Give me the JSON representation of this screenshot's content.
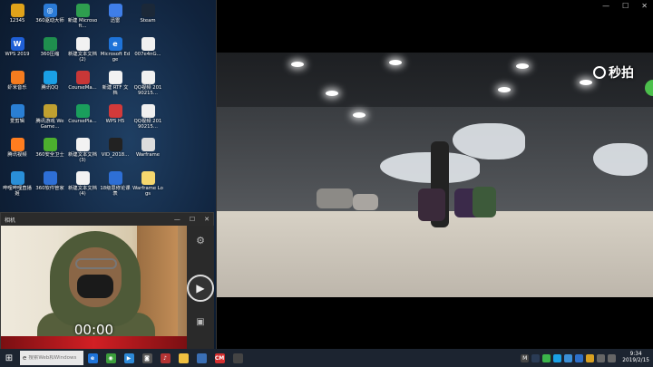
{
  "desktop": {
    "icons": [
      {
        "label": "12345",
        "color": "#e0a31a",
        "glyph": ""
      },
      {
        "label": "360驱动大师",
        "color": "#2b7bd6",
        "glyph": "◎"
      },
      {
        "label": "新建 Microsoft...",
        "color": "#2e9e4f",
        "glyph": ""
      },
      {
        "label": "迅雷",
        "color": "#3f7ee8",
        "glyph": ""
      },
      {
        "label": "Steam",
        "color": "#1b2838",
        "glyph": ""
      },
      {
        "label": "",
        "color": "transparent",
        "glyph": ""
      },
      {
        "label": "WPS 2019",
        "color": "#1f5fd6",
        "glyph": "W"
      },
      {
        "label": "360压缩",
        "color": "#1f8f4e",
        "glyph": ""
      },
      {
        "label": "新建文本文档 (2)",
        "color": "#f2f2f2",
        "glyph": ""
      },
      {
        "label": "Microsoft Edge",
        "color": "#1e73d8",
        "glyph": "e"
      },
      {
        "label": "007e4nG...",
        "color": "#f0f0f0",
        "glyph": ""
      },
      {
        "label": "",
        "color": "transparent",
        "glyph": ""
      },
      {
        "label": "虾米音乐",
        "color": "#f57c1f",
        "glyph": ""
      },
      {
        "label": "腾讯QQ",
        "color": "#1aa0e6",
        "glyph": ""
      },
      {
        "label": "CourseMa...",
        "color": "#c83737",
        "glyph": ""
      },
      {
        "label": "新建 RTF 文档",
        "color": "#f2f2f2",
        "glyph": ""
      },
      {
        "label": "QQ视频 20190215...",
        "color": "#f0f0f0",
        "glyph": ""
      },
      {
        "label": "",
        "color": "transparent",
        "glyph": ""
      },
      {
        "label": "爱剪辑",
        "color": "#2a7fd4",
        "glyph": ""
      },
      {
        "label": "腾讯游戏 WeGame...",
        "color": "#c0a030",
        "glyph": ""
      },
      {
        "label": "CoursePla...",
        "color": "#1a9e5c",
        "glyph": ""
      },
      {
        "label": "WPS H5",
        "color": "#d23a3a",
        "glyph": ""
      },
      {
        "label": "QQ视频 20190215...",
        "color": "#f0f0f0",
        "glyph": ""
      },
      {
        "label": "",
        "color": "transparent",
        "glyph": ""
      },
      {
        "label": "腾讯视频",
        "color": "#ff7d1f",
        "glyph": ""
      },
      {
        "label": "360安全卫士",
        "color": "#4caf2e",
        "glyph": ""
      },
      {
        "label": "新建文本文档 (3)",
        "color": "#f2f2f2",
        "glyph": ""
      },
      {
        "label": "VID_2018...",
        "color": "#222222",
        "glyph": ""
      },
      {
        "label": "Warframe",
        "color": "#dcdcdc",
        "glyph": ""
      },
      {
        "label": "",
        "color": "transparent",
        "glyph": ""
      },
      {
        "label": "哔哩哔哩直播姬",
        "color": "#2a8fd8",
        "glyph": ""
      },
      {
        "label": "360软件管家",
        "color": "#2e6fd6",
        "glyph": ""
      },
      {
        "label": "新建文本文档 (4)",
        "color": "#f2f2f2",
        "glyph": ""
      },
      {
        "label": "18级思修论课表",
        "color": "#2e6fd6",
        "glyph": ""
      },
      {
        "label": "Warframe Logs",
        "color": "#f5d76e",
        "glyph": ""
      },
      {
        "label": "",
        "color": "transparent",
        "glyph": ""
      }
    ]
  },
  "camera": {
    "title": "相机",
    "controls": [
      "—",
      "☐",
      "✕"
    ],
    "timer": "00:00",
    "settings_icon": "⚙",
    "record_icon": "▶",
    "photo_icon": "▣"
  },
  "player": {
    "controls": [
      "—",
      "☐",
      "✕"
    ],
    "watermark": "秒拍"
  },
  "taskbar": {
    "start_glyph": "⊞",
    "search_placeholder": "搜索Web和Windows",
    "search_icon": "e",
    "apps": [
      {
        "name": "edge",
        "color": "#1e73d8",
        "glyph": "e"
      },
      {
        "name": "app-green",
        "color": "#3c9e3c",
        "glyph": "◉"
      },
      {
        "name": "store",
        "color": "#2e8ad8",
        "glyph": "▶"
      },
      {
        "name": "camera",
        "color": "#555555",
        "glyph": "◙"
      },
      {
        "name": "music",
        "color": "#b33333",
        "glyph": "♪"
      },
      {
        "name": "explorer",
        "color": "#f0c040",
        "glyph": ""
      },
      {
        "name": "photos",
        "color": "#3a6fb5",
        "glyph": ""
      },
      {
        "name": "cm",
        "color": "#d42e2e",
        "glyph": "CM"
      },
      {
        "name": "film",
        "color": "#444444",
        "glyph": ""
      }
    ],
    "tray": [
      {
        "name": "m-icon",
        "color": "#444444",
        "glyph": "M"
      },
      {
        "name": "steam",
        "color": "#2a3b55",
        "glyph": ""
      },
      {
        "name": "wechat",
        "color": "#3bb44a",
        "glyph": ""
      },
      {
        "name": "qq",
        "color": "#1aa0e6",
        "glyph": ""
      },
      {
        "name": "security",
        "color": "#3b8fd6",
        "glyph": ""
      },
      {
        "name": "bluetooth",
        "color": "#2d6fc8",
        "glyph": ""
      },
      {
        "name": "battery",
        "color": "#d8a020",
        "glyph": ""
      },
      {
        "name": "network",
        "color": "#666666",
        "glyph": ""
      },
      {
        "name": "sound",
        "color": "#666666",
        "glyph": ""
      }
    ],
    "time": "9:34",
    "date": "2019/2/15"
  }
}
